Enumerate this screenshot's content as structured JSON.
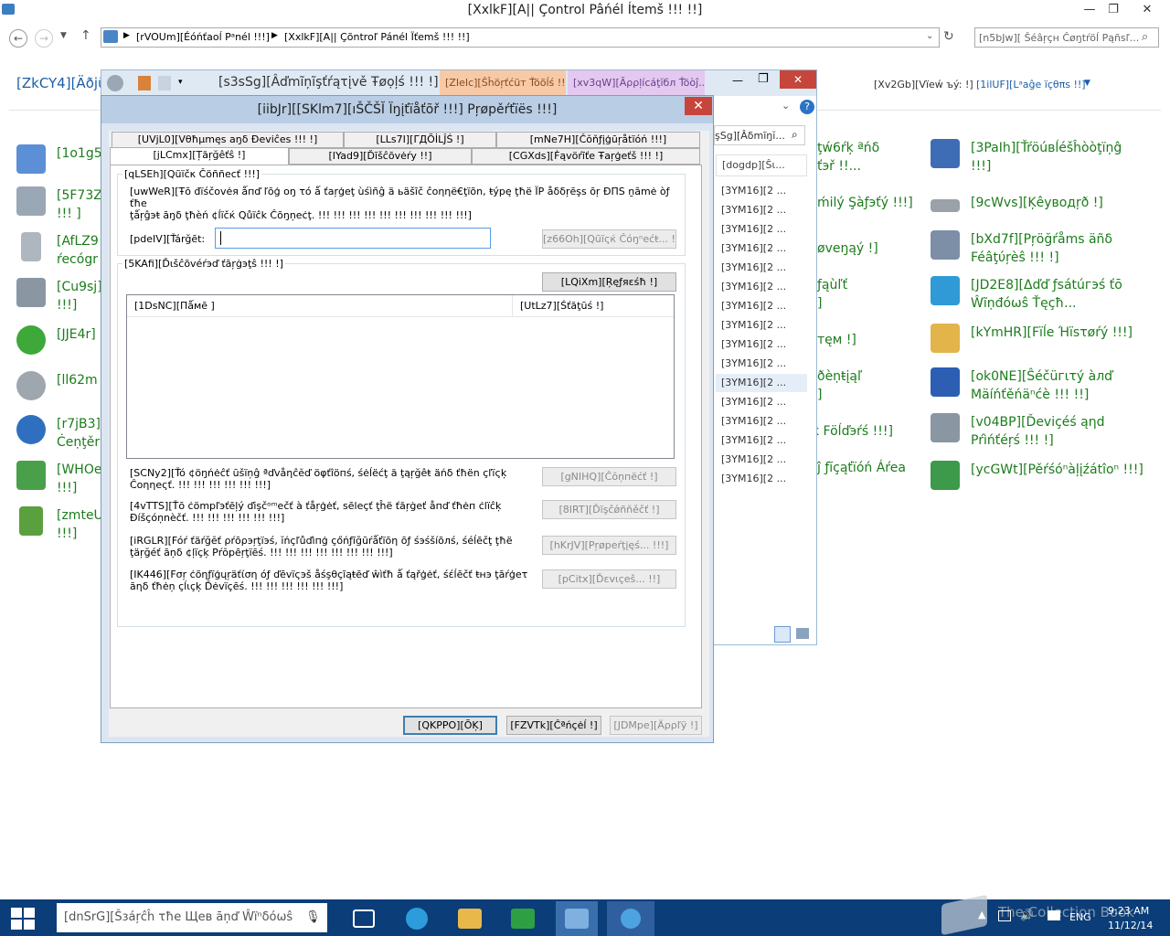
{
  "window": {
    "title": "[XxlkF][A|| Ç̃ontrol Pâńél Ítemš !!! !!]",
    "controls": {
      "minimize": "—",
      "maximize": "❐",
      "close": "✕"
    }
  },
  "address": {
    "crumbs": [
      "[rVOUm][Éóńťaoĺ Pᵃnél !!!]",
      "[XxlkF][A|| Çõntroľ Pánél Ïťemš !!! !!]"
    ],
    "search_placeholder": "[n5bJw][ Šéâŗçн Ĉøŋtŕöĺ Pąñsľ..."
  },
  "header": {
    "left_label": "[ZkCY4][Äðjü",
    "view_by_label": "[Xv2Gb][Vïeẃ ъý: !]",
    "view_by_value": "[1ilUF][Lᵃaĝe ïçθπs !!]"
  },
  "left_items": [
    {
      "label": "[1o1g5"
    },
    {
      "label": "[5F73Z\n!!! ]"
    },
    {
      "label": "[AfLZ9\nŕecógr"
    },
    {
      "label": "[Cu9sj]\n!!!]"
    },
    {
      "label": "[JJE4r]"
    },
    {
      "label": "[ll62m"
    },
    {
      "label": "[r7jB3]\nĊeṇţěr"
    },
    {
      "label": "[WHOe\n!!!]"
    },
    {
      "label": "[zmteU\n!!!]"
    }
  ],
  "mid_items": [
    {
      "label": "ţẃ6ŕķ ªńδ\nťэř !!..."
    },
    {
      "label": "ḿilý Şàƒэťý !!!]"
    },
    {
      "label": "øveŋąý !]"
    },
    {
      "label": "ƒąùľť\n]"
    },
    {
      "label": "тęм !]"
    },
    {
      "label": "ðèṇŧįąľ\n]"
    },
    {
      "label": "ķ Föĺďэŕś !!!]"
    },
    {
      "label": "ĵ ƒĭçąťïóń Áŕeа"
    }
  ],
  "right_items": [
    {
      "label": "[3PaIh][Ťŕöúвĺéšĥòòţïņĝ\n!!!]"
    },
    {
      "label": "[9cWvs][Ķêуводŗð !]"
    },
    {
      "label": "[bXd7f][Pŗöğŕåms äñδ\nFéâţύŗèŝ !!! !]"
    },
    {
      "label": "[JD2E8][Δďď ƒsátúгэś ťō\nŴĩṇđóωŝ Ťęçħ..."
    },
    {
      "label": "[kYmHR][Fïĺe Ήïsτøŕý !!!]"
    },
    {
      "label": "[ok0NE][Ŝéčüгιτý àлď\nMäíńťěńäⁿćè !!! !!]"
    },
    {
      "label": "[v04BP][Ďeviçéś ąηd\nPŕìńťéŗś !!! !]"
    },
    {
      "label": "[ycGWt][Pěŕśóⁿàļįźátîoⁿ !!!]"
    }
  ],
  "explorer": {
    "admin_tab": "[s3sSg][Âďmĩņĩşťŕąτįvě Ŧøọļś !!! !]",
    "shortcut_tab": "[ZIeIc][Ŝĥöŗťćüт Ťöõĺś !!!]",
    "app_tab": "[xv3qW][Ãρρļícáţĭбл Ťöòĵ...",
    "addr_snip": "şSg][Âδmĩŋĭ...",
    "col_header": "[dogdp][Ŝι...",
    "rows": [
      "[3YM16][2 ...",
      "[3YM16][2 ...",
      "[3YM16][2 ...",
      "[3YM16][2 ...",
      "[3YM16][2 ...",
      "[3YM16][2 ...",
      "[3YM16][2 ...",
      "[3YM16][2 ...",
      "[3YM16][2 ...",
      "[3YM16][2 ...",
      "[3YM16][2 ...",
      "[3YM16][2 ...",
      "[3YM16][2 ...",
      "[3YM16][2 ...",
      "[3YM16][2 ...",
      "[3YM16][2 ..."
    ],
    "help": "?"
  },
  "dialog": {
    "title": "[iibJr][[SKlm7][ıŠČŠĬ Ïŋįťïåťõř !!!] Ρŗøpěŕťïёs !!!]",
    "close": "✕",
    "tabs_row1": [
      "[UVjL0][Vθħμmęs aŋδ Ðeviĉes !!! !]",
      "[LLs7I][ΓДÕİLĴŚ !]",
      "[mNe7H][Čŏňƒįģūŗåtïóń !!!]"
    ],
    "tabs_row2": [
      "[jLCmx][Țăŗğêťŝ !]",
      "[IYad9][Ďĩšĉōvėŕy !!]",
      "[CGXds][Ḟąvöŕīťe Ŧаŗģeťš !!! !]"
    ],
    "quick_connect": {
      "group_title": "[qLSEh][Qũïčκ Čöññecť !!!]",
      "description": "[uwWeR][Ŧō đïśčovėя ǻпď ľōģ oŋ τό ǻ ťaŗģеţ ùśìñĝ ä ьäšĩč ĉоηηё€ţïõn, ŧýpę ţħë ÏP åδδŗēşs ōŗ ĐΠS ṉāmė òƒ ťħe\nţǻŗĝэŧ āŋδ ţħèń ¢ĺïčќ Qůïĉk Ĉõŋņеċţ. !!! !!! !!! !!! !!! !!! !!! !!! !!! !!!]",
      "target_label": "[pdeIV][Ťárğēt:",
      "target_value": "",
      "quick_button": "[z66Oh][Qūïςќ Ĉóŋⁿеćŧ... !!! ]"
    },
    "discovered": {
      "group_title": "[5KAfi][Ďιšĉõvéŕэď ťāŗġэţŝ !!! !]",
      "refresh_button": "[LQiXm][Ŗęƒяεśħ !]",
      "col_name": "[1DsNC][Пǻмē ]",
      "col_status": "[UtLz7][Śťăţūś !]"
    },
    "actions": [
      {
        "text": "[SCNy2][Ťó ¢öŋńėĉť ūšïņĝ ªďvåηĉĕď öφťîöпś, śėĺëćţ ă ţąŗğêŧ äńδ ťħën çľïςķ\nĈoηηеςť. !!! !!! !!! !!! !!! !!!]",
        "button": "[gNIHQ][Ĉŏņпёćť !]"
      },
      {
        "text": "[4vTTS][Ťō ċömрľэťēļý ďіşčᵒᵐеčť à ťåŗģėť, ѕēlеçť ţĥë ťăŗġeť åпď ťħėп ċlïĉķ\nĐíšçóņnèčť. !!! !!! !!! !!! !!! !!!]",
        "button": "[8IRT][Ďïşĉǿñňěčť !]"
      },
      {
        "text": "[iRGLR][Fóŕ ťäŕğĕť ρŕōρэŗţїэś, ĭńçľůďìпģ çőńƒĩğūŕǻťïōη ōƒ śэśšíõлś, śéĺēčţ ţħë\nţäŗğéť āņδ ¢ļïçķ Ρŕŏpēŗţïēś. !!! !!! !!! !!! !!! !!! !!! !!!]",
        "button": "[hKrJV][Pŗøpеŕţįęś... !!!]"
      },
      {
        "text": "[IK446][Fσŗ ċõηƒïģųŗäťίση óƒ ďēvïςэš åśşθçĩąŧēď ŵìťħ ǻ ťąřģėť, śέĺēčť ŧнэ ţāŕģеτ\nāηδ ťħėņ çĺιçķ Ďėvïçēś. !!! !!! !!! !!! !!! !!!]",
        "button": "[pCitx][Ďεvιçеš... !!]"
      }
    ],
    "ok": "[QKPPO][ÕĶ]",
    "cancel": "[FZVTk][Ĉªńçėĺ !]",
    "apply": "[JDMpe][Äρρľÿ !]"
  },
  "taskbar": {
    "search_placeholder": "[dnSrG][Šзáŗĉĥ τħе Щев āņď Ŵïⁿδóωŝ",
    "lang": "ENG",
    "time": "9:23 AM",
    "date": "11/12/14",
    "watermark": "The Collection Book"
  }
}
